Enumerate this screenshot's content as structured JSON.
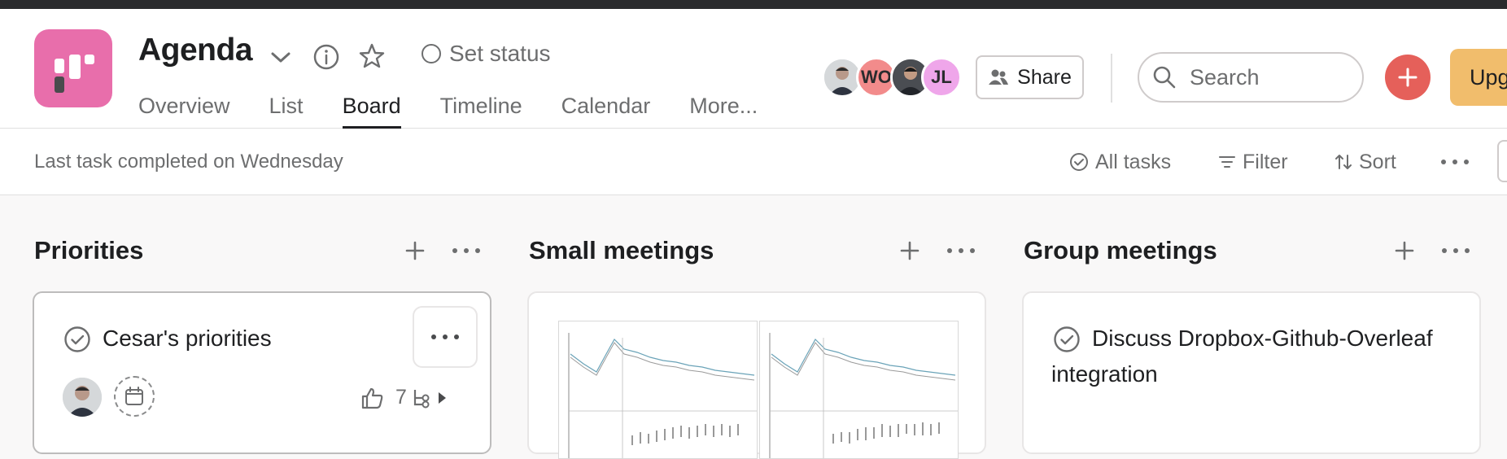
{
  "project": {
    "title": "Agenda",
    "set_status_label": "Set status",
    "icon_color": "#e86eab"
  },
  "tabs": [
    {
      "label": "Overview"
    },
    {
      "label": "List"
    },
    {
      "label": "Board",
      "active": true
    },
    {
      "label": "Timeline"
    },
    {
      "label": "Calendar"
    },
    {
      "label": "More..."
    }
  ],
  "members": [
    {
      "initials": "",
      "kind": "photo"
    },
    {
      "initials": "WO",
      "color": "#f28b8b"
    },
    {
      "initials": "",
      "kind": "photo"
    },
    {
      "initials": "JL",
      "color": "#efa6ea"
    }
  ],
  "share_label": "Share",
  "search": {
    "placeholder": "Search"
  },
  "upgrade_label": "Upg",
  "colors": {
    "add_button": "#e5605a",
    "upgrade_button": "#f1bd6c"
  },
  "toolbar": {
    "status_text": "Last task completed on Wednesday",
    "all_tasks_label": "All tasks",
    "filter_label": "Filter",
    "sort_label": "Sort"
  },
  "columns": [
    {
      "title": "Priorities",
      "card": {
        "title": "Cesar's priorities",
        "likes": "7"
      }
    },
    {
      "title": "Small meetings",
      "card": {
        "title": ""
      }
    },
    {
      "title": "Group meetings",
      "card": {
        "title": "Discuss Dropbox-Github-Overleaf integration"
      }
    }
  ]
}
